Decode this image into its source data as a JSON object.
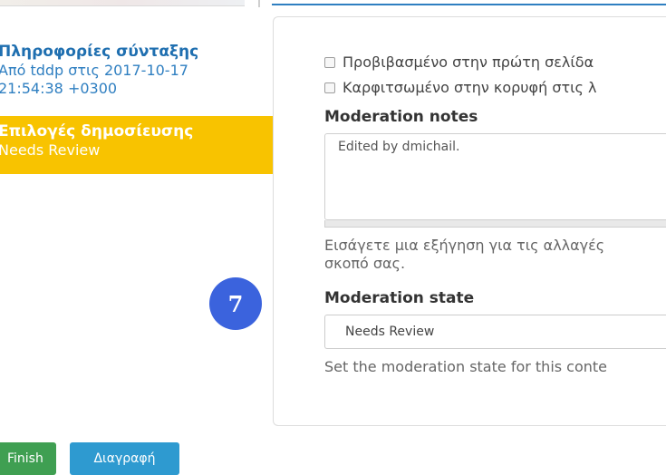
{
  "vertical_tabs": {
    "authoring": {
      "title": "Πληροφορίες σύνταξης",
      "summary": "Από tddp στις 2017-10-17\n21:54:38 +0300"
    },
    "publishing": {
      "title": "Επιλογές δημοσίευσης",
      "summary": "Needs Review"
    }
  },
  "publishing_options": {
    "promoted_label": "Προβιβασμένο στην πρώτη σελίδα",
    "sticky_label": "Καρφιτσωμένο στην κορυφή στις λ",
    "moderation_notes": {
      "label": "Moderation notes",
      "value": "Edited by dmichail.",
      "description": "Εισάγετε μια εξήγηση για τις αλλαγές\nσκοπό σας."
    },
    "moderation_state": {
      "label": "Moderation state",
      "selected": "Needs Review",
      "help": "Set the moderation state for this conte"
    }
  },
  "step_badge": "7",
  "actions": {
    "finish_label": "Finish",
    "delete_label": "Διαγραφή"
  },
  "colors": {
    "active_tab": "#f8c300",
    "link_blue": "#2f7fc1",
    "badge_blue": "#3b63dd",
    "finish_green": "#3f9f52",
    "delete_blue": "#2e9ad0"
  }
}
